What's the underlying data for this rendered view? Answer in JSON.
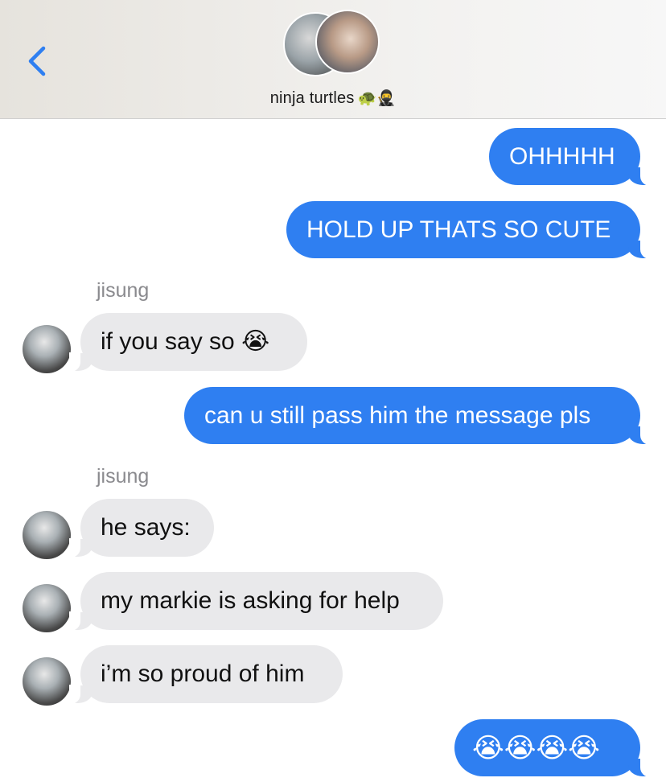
{
  "header": {
    "group_name": "ninja turtles",
    "group_emoji": "🐢🥷"
  },
  "messages": [
    {
      "text": "OHHHHH"
    },
    {
      "text": "HOLD UP THATS SO CUTE"
    },
    {
      "text": "if you say so 😭"
    },
    {
      "text": "can u still pass him the message pls"
    },
    {
      "text": "he says:"
    },
    {
      "text": "my markie is asking for help"
    },
    {
      "text": "i’m so proud of him"
    },
    {
      "text": "😭😭😭😭"
    }
  ],
  "senders": [
    "jisung",
    "jisung"
  ],
  "colors": {
    "outgoing_bubble": "#2f7ff1",
    "incoming_bubble": "#e9e9eb",
    "back_accent": "#2f7ff1",
    "sender_label": "#8a8a8e"
  },
  "icons": {
    "back": "chevron-left-icon"
  }
}
